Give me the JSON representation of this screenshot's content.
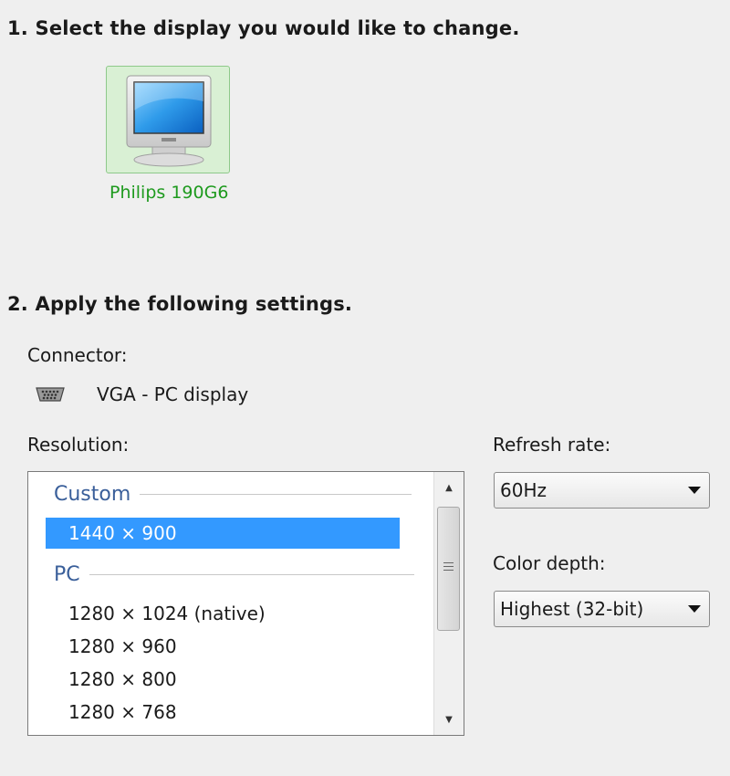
{
  "step1": {
    "title": "1. Select the display you would like to change."
  },
  "display": {
    "name": "Philips 190G6"
  },
  "step2": {
    "title": "2. Apply the following settings."
  },
  "connector": {
    "label": "Connector:",
    "value": "VGA - PC display"
  },
  "resolution": {
    "label": "Resolution:",
    "groups": [
      {
        "header": "Custom",
        "items": [
          "1440 × 900"
        ]
      },
      {
        "header": "PC",
        "items": [
          "1280 × 1024 (native)",
          "1280 × 960",
          "1280 × 800",
          "1280 × 768"
        ]
      }
    ],
    "selected": "1440 × 900"
  },
  "refresh_rate": {
    "label": "Refresh rate:",
    "value": "60Hz"
  },
  "color_depth": {
    "label": "Color depth:",
    "value": "Highest (32-bit)"
  },
  "colors": {
    "selection": "#3399ff",
    "display_name": "#1e9a1e",
    "tile_bg": "#d9f0d4"
  }
}
